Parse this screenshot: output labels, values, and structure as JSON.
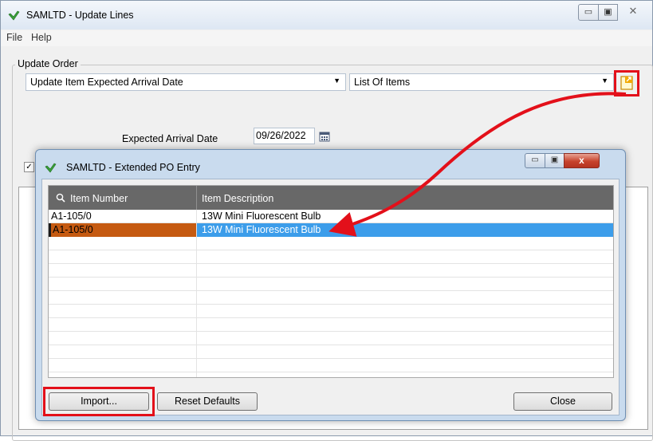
{
  "main_window": {
    "title": "SAMLTD - Update Lines",
    "controls": {
      "minimize": "▭",
      "maximize": "▣",
      "close": "✕"
    }
  },
  "menu": {
    "items": [
      "File",
      "Help"
    ]
  },
  "update_order": {
    "group_label": "Update Order",
    "action_selected": "Update Item Expected Arrival Date",
    "source_selected": "List Of Items",
    "expected_arrival_label": "Expected Arrival Date",
    "expected_arrival_value": "09/26/2022",
    "checkbox_checked": true
  },
  "dialog": {
    "title": "SAMLTD - Extended PO Entry",
    "controls": {
      "minimize": "▭",
      "maximize": "▣",
      "close": "x"
    },
    "grid": {
      "columns": [
        "Item Number",
        "Item Description"
      ],
      "rows": [
        {
          "item_number": "A1-105/0",
          "item_description": "13W Mini Fluorescent Bulb",
          "selected": false
        },
        {
          "item_number": "A1-105/0",
          "item_description": "13W Mini Fluorescent Bulb",
          "selected": true
        }
      ]
    },
    "buttons": {
      "import": "Import...",
      "reset_defaults": "Reset Defaults",
      "close": "Close"
    }
  },
  "icons": {
    "app": "green-check-app-icon",
    "extended_entry": "orange-popup-icon",
    "calendar": "calendar-icon",
    "search": "search-icon"
  },
  "colors": {
    "highlight": "#e3101a",
    "selected_cell": "#c55a11",
    "selected_row": "#3c9dea",
    "grid_header": "#686868"
  }
}
